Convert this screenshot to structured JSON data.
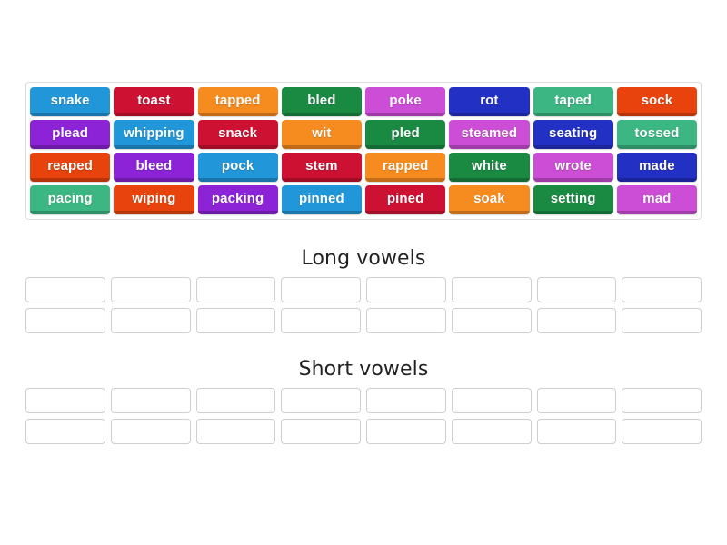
{
  "activity": {
    "type": "group-sort",
    "palette": {
      "blue": "#2196d9",
      "red": "#cc1133",
      "orange": "#f68b1f",
      "dark_green": "#1a8a43",
      "magenta": "#cc4ed6",
      "navy": "#2330c4",
      "sea_green": "#3cb683",
      "orange_red": "#e8430c",
      "violet": "#8c23d6",
      "tile_text": "#ffffff",
      "panel_border": "#dcdcdc",
      "slot_border": "#cfcfcf",
      "heading_text": "#222222",
      "page_bg": "#ffffff"
    }
  },
  "word_bank": {
    "name": "word-bank",
    "columns": 8,
    "rows": 4,
    "tiles": [
      {
        "label": "snake",
        "color": "#2196d9"
      },
      {
        "label": "toast",
        "color": "#cc1133"
      },
      {
        "label": "tapped",
        "color": "#f68b1f"
      },
      {
        "label": "bled",
        "color": "#1a8a43"
      },
      {
        "label": "poke",
        "color": "#cc4ed6"
      },
      {
        "label": "rot",
        "color": "#2330c4"
      },
      {
        "label": "taped",
        "color": "#3cb683"
      },
      {
        "label": "sock",
        "color": "#e8430c"
      },
      {
        "label": "plead",
        "color": "#8c23d6"
      },
      {
        "label": "whipping",
        "color": "#2196d9"
      },
      {
        "label": "snack",
        "color": "#cc1133"
      },
      {
        "label": "wit",
        "color": "#f68b1f"
      },
      {
        "label": "pled",
        "color": "#1a8a43"
      },
      {
        "label": "steamed",
        "color": "#cc4ed6"
      },
      {
        "label": "seating",
        "color": "#2330c4"
      },
      {
        "label": "tossed",
        "color": "#3cb683"
      },
      {
        "label": "reaped",
        "color": "#e8430c"
      },
      {
        "label": "bleed",
        "color": "#8c23d6"
      },
      {
        "label": "pock",
        "color": "#2196d9"
      },
      {
        "label": "stem",
        "color": "#cc1133"
      },
      {
        "label": "rapped",
        "color": "#f68b1f"
      },
      {
        "label": "white",
        "color": "#1a8a43"
      },
      {
        "label": "wrote",
        "color": "#cc4ed6"
      },
      {
        "label": "made",
        "color": "#2330c4"
      },
      {
        "label": "pacing",
        "color": "#3cb683"
      },
      {
        "label": "wiping",
        "color": "#e8430c"
      },
      {
        "label": "packing",
        "color": "#8c23d6"
      },
      {
        "label": "pinned",
        "color": "#2196d9"
      },
      {
        "label": "pined",
        "color": "#cc1133"
      },
      {
        "label": "soak",
        "color": "#f68b1f"
      },
      {
        "label": "setting",
        "color": "#1a8a43"
      },
      {
        "label": "mad",
        "color": "#cc4ed6"
      }
    ]
  },
  "groups": [
    {
      "id": "long",
      "title": "Long vowels",
      "slot_count": 16,
      "slot_columns": 8,
      "slots": [
        "",
        "",
        "",
        "",
        "",
        "",
        "",
        "",
        "",
        "",
        "",
        "",
        "",
        "",
        "",
        ""
      ]
    },
    {
      "id": "short",
      "title": "Short vowels",
      "slot_count": 16,
      "slot_columns": 8,
      "slots": [
        "",
        "",
        "",
        "",
        "",
        "",
        "",
        "",
        "",
        "",
        "",
        "",
        "",
        "",
        "",
        ""
      ]
    }
  ]
}
